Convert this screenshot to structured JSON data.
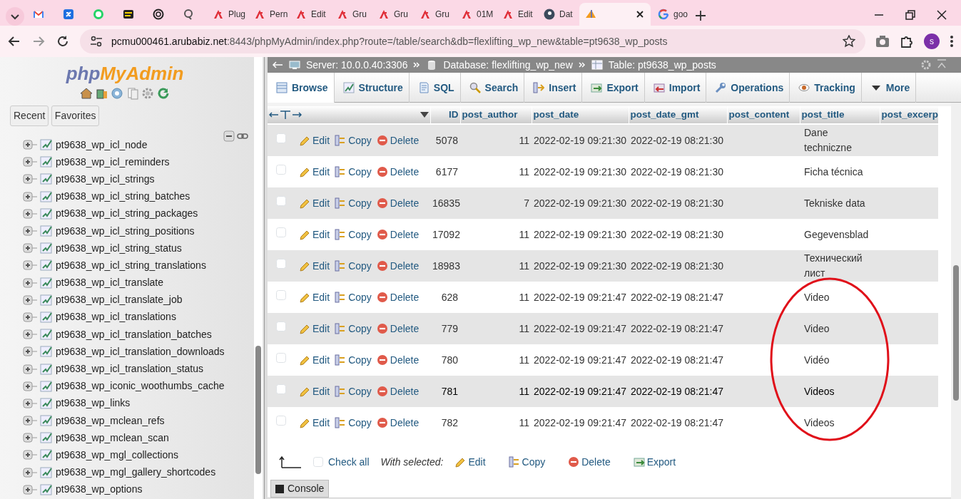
{
  "browser": {
    "tabs": [
      {
        "kind": "mail",
        "selected": false
      },
      {
        "kind": "app",
        "selected": false
      },
      {
        "kind": "chat",
        "selected": false
      },
      {
        "kind": "terminal",
        "selected": false
      },
      {
        "kind": "knot",
        "selected": false
      },
      {
        "kind": "lens",
        "selected": false
      },
      {
        "kind": "flex",
        "title": "Plug",
        "selected": false
      },
      {
        "kind": "flex",
        "title": "Pern",
        "selected": false
      },
      {
        "kind": "flex",
        "title": "Edit",
        "selected": false
      },
      {
        "kind": "flex",
        "title": "Gru",
        "selected": false
      },
      {
        "kind": "flex",
        "title": "Gru",
        "selected": false
      },
      {
        "kind": "flex",
        "title": "Gru",
        "selected": false
      },
      {
        "kind": "flex",
        "title": "01M",
        "selected": false
      },
      {
        "kind": "flex",
        "title": "Edit",
        "selected": false
      },
      {
        "kind": "circle",
        "title": "Dat",
        "selected": false
      },
      {
        "kind": "sail",
        "selected": true
      },
      {
        "kind": "google",
        "title": "goo",
        "selected": false
      }
    ],
    "url_host": "pcmu000461.arubabiz.net",
    "url_rest": ":8443/phpMyAdmin/index.php?route=/table/search&db=flexlifting_wp_new&table=pt9638_wp_posts",
    "profile": "s"
  },
  "sidebar": {
    "logo": [
      "php",
      "MyAdmin"
    ],
    "buttons": [
      "Recent",
      "Favorites"
    ],
    "tables": [
      {
        "name": "pt9638_wp_icl_node",
        "expanded": false
      },
      {
        "name": "pt9638_wp_icl_reminders",
        "expanded": false
      },
      {
        "name": "pt9638_wp_icl_strings",
        "expanded": false
      },
      {
        "name": "pt9638_wp_icl_string_batches",
        "expanded": false
      },
      {
        "name": "pt9638_wp_icl_string_packages",
        "expanded": false
      },
      {
        "name": "pt9638_wp_icl_string_positions",
        "expanded": false
      },
      {
        "name": "pt9638_wp_icl_string_status",
        "expanded": false
      },
      {
        "name": "pt9638_wp_icl_string_translations",
        "expanded": false
      },
      {
        "name": "pt9638_wp_icl_translate",
        "expanded": false
      },
      {
        "name": "pt9638_wp_icl_translate_job",
        "expanded": false
      },
      {
        "name": "pt9638_wp_icl_translations",
        "expanded": false
      },
      {
        "name": "pt9638_wp_icl_translation_batches",
        "expanded": false
      },
      {
        "name": "pt9638_wp_icl_translation_downloads",
        "expanded": false
      },
      {
        "name": "pt9638_wp_icl_translation_status",
        "expanded": false
      },
      {
        "name": "pt9638_wp_iconic_woothumbs_cache",
        "expanded": false
      },
      {
        "name": "pt9638_wp_links",
        "expanded": false
      },
      {
        "name": "pt9638_wp_mclean_refs",
        "expanded": false
      },
      {
        "name": "pt9638_wp_mclean_scan",
        "expanded": false
      },
      {
        "name": "pt9638_wp_mgl_collections",
        "expanded": false
      },
      {
        "name": "pt9638_wp_mgl_gallery_shortcodes",
        "expanded": false
      },
      {
        "name": "pt9638_wp_options",
        "expanded": false
      }
    ]
  },
  "breadcrumb": [
    {
      "kind": "server",
      "label": "Server: 10.0.0.40:3306"
    },
    {
      "kind": "database",
      "label": "Database: flexlifting_wp_new"
    },
    {
      "kind": "table",
      "label": "Table: pt9638_wp_posts"
    }
  ],
  "tabs": [
    {
      "label": "Browse",
      "kind": "browse",
      "selected": true
    },
    {
      "label": "Structure",
      "kind": "structure",
      "selected": false
    },
    {
      "label": "SQL",
      "kind": "sql",
      "selected": false
    },
    {
      "label": "Search",
      "kind": "search",
      "selected": false
    },
    {
      "label": "Insert",
      "kind": "insert",
      "selected": false
    },
    {
      "label": "Export",
      "kind": "export",
      "selected": false
    },
    {
      "label": "Import",
      "kind": "import",
      "selected": false
    },
    {
      "label": "Operations",
      "kind": "operations",
      "selected": false
    },
    {
      "label": "Tracking",
      "kind": "tracking",
      "selected": false
    },
    {
      "label": "More",
      "kind": "more",
      "selected": false
    }
  ],
  "table": {
    "columns": [
      "ID",
      "post_author",
      "post_date",
      "post_date_gmt",
      "post_content",
      "post_title",
      "post_excerp"
    ],
    "rows": [
      {
        "checked": false,
        "hovered": false,
        "actions": [
          "Edit",
          "Copy",
          "Delete"
        ],
        "id": "5078",
        "post_author": "11",
        "post_date": "2022-02-19 09:21:30",
        "post_date_gmt": "2022-02-19 08:21:30",
        "post_title": "Dane techniczne"
      },
      {
        "checked": false,
        "hovered": false,
        "actions": [
          "Edit",
          "Copy",
          "Delete"
        ],
        "id": "6177",
        "post_author": "11",
        "post_date": "2022-02-19 09:21:30",
        "post_date_gmt": "2022-02-19 08:21:30",
        "post_title": "Ficha técnica"
      },
      {
        "checked": false,
        "hovered": false,
        "actions": [
          "Edit",
          "Copy",
          "Delete"
        ],
        "id": "16835",
        "post_author": "7",
        "post_date": "2022-02-19 09:21:30",
        "post_date_gmt": "2022-02-19 08:21:30",
        "post_title": "Tekniske data"
      },
      {
        "checked": false,
        "hovered": false,
        "actions": [
          "Edit",
          "Copy",
          "Delete"
        ],
        "id": "17092",
        "post_author": "11",
        "post_date": "2022-02-19 09:21:30",
        "post_date_gmt": "2022-02-19 08:21:30",
        "post_title": "Gegevensblad"
      },
      {
        "checked": false,
        "hovered": false,
        "actions": [
          "Edit",
          "Copy",
          "Delete"
        ],
        "id": "18983",
        "post_author": "11",
        "post_date": "2022-02-19 09:21:30",
        "post_date_gmt": "2022-02-19 08:21:30",
        "post_title": "Технический лист"
      },
      {
        "checked": false,
        "hovered": false,
        "actions": [
          "Edit",
          "Copy",
          "Delete"
        ],
        "id": "628",
        "post_author": "11",
        "post_date": "2022-02-19 09:21:47",
        "post_date_gmt": "2022-02-19 08:21:47",
        "post_title": "Video"
      },
      {
        "checked": false,
        "hovered": false,
        "actions": [
          "Edit",
          "Copy",
          "Delete"
        ],
        "id": "779",
        "post_author": "11",
        "post_date": "2022-02-19 09:21:47",
        "post_date_gmt": "2022-02-19 08:21:47",
        "post_title": "Video"
      },
      {
        "checked": false,
        "hovered": false,
        "actions": [
          "Edit",
          "Copy",
          "Delete"
        ],
        "id": "780",
        "post_author": "11",
        "post_date": "2022-02-19 09:21:47",
        "post_date_gmt": "2022-02-19 08:21:47",
        "post_title": "Vidéo"
      },
      {
        "checked": false,
        "hovered": true,
        "actions": [
          "Edit",
          "Copy",
          "Delete"
        ],
        "id": "781",
        "post_author": "11",
        "post_date": "2022-02-19 09:21:47",
        "post_date_gmt": "2022-02-19 08:21:47",
        "post_title": "Videos"
      },
      {
        "checked": false,
        "hovered": false,
        "actions": [
          "Edit",
          "Copy",
          "Delete"
        ],
        "id": "782",
        "post_author": "11",
        "post_date": "2022-02-19 09:21:47",
        "post_date_gmt": "2022-02-19 08:21:47",
        "post_title": "Videos"
      }
    ]
  },
  "footer": {
    "check_all": {
      "label": "Check all",
      "checked": false
    },
    "with_selected": "With selected:",
    "actions": [
      {
        "kind": "edit",
        "label": "Edit"
      },
      {
        "kind": "copy",
        "label": "Copy"
      },
      {
        "kind": "delete",
        "label": "Delete"
      },
      {
        "kind": "export",
        "label": "Export"
      }
    ]
  },
  "console": "Console"
}
